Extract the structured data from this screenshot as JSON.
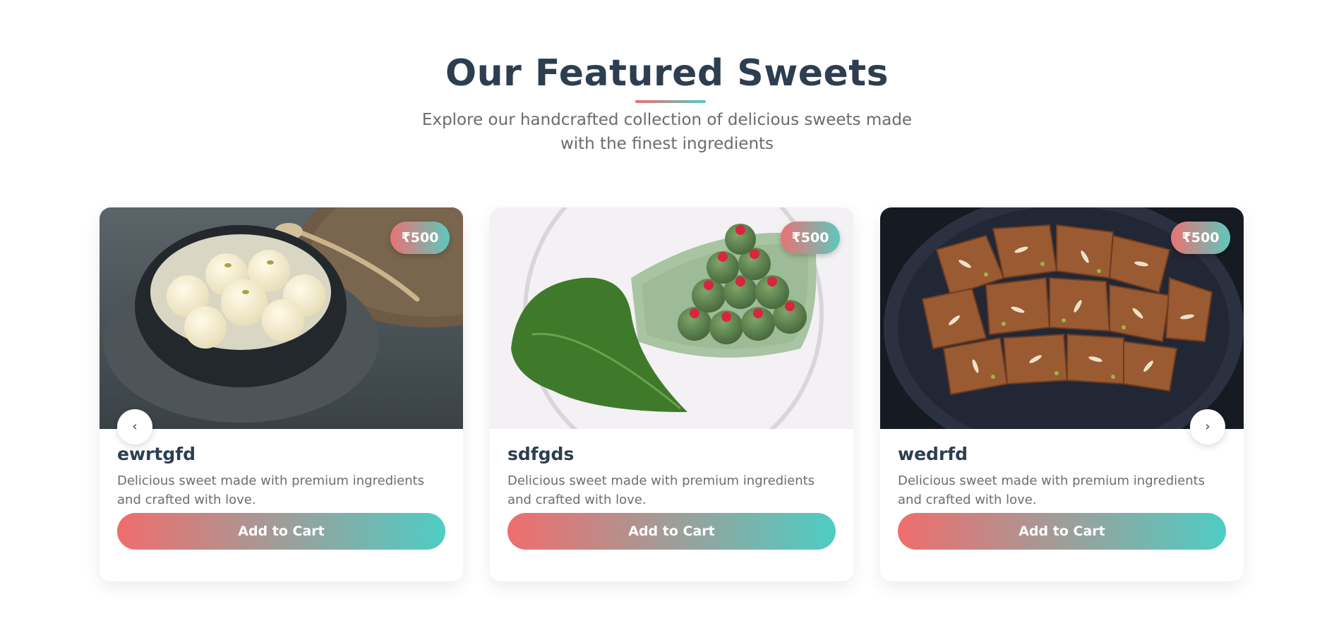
{
  "section": {
    "title": "Our Featured Sweets",
    "subtitle": "Explore our handcrafted collection of delicious sweets made with the finest ingredients",
    "accent_colors": [
      "#f06d6d",
      "#4ecdc4"
    ]
  },
  "carousel": {
    "prev_label": "‹",
    "next_label": "›"
  },
  "products": [
    {
      "name": "ewrtgfd",
      "price": "₹500",
      "description": "Delicious sweet made with premium ingredients and crafted with love.",
      "button_label": "Add to Cart"
    },
    {
      "name": "sdfgds",
      "price": "₹500",
      "description": "Delicious sweet made with premium ingredients and crafted with love.",
      "button_label": "Add to Cart"
    },
    {
      "name": "wedrfd",
      "price": "₹500",
      "description": "Delicious sweet made with premium ingredients and crafted with love.",
      "button_label": "Add to Cart"
    }
  ]
}
